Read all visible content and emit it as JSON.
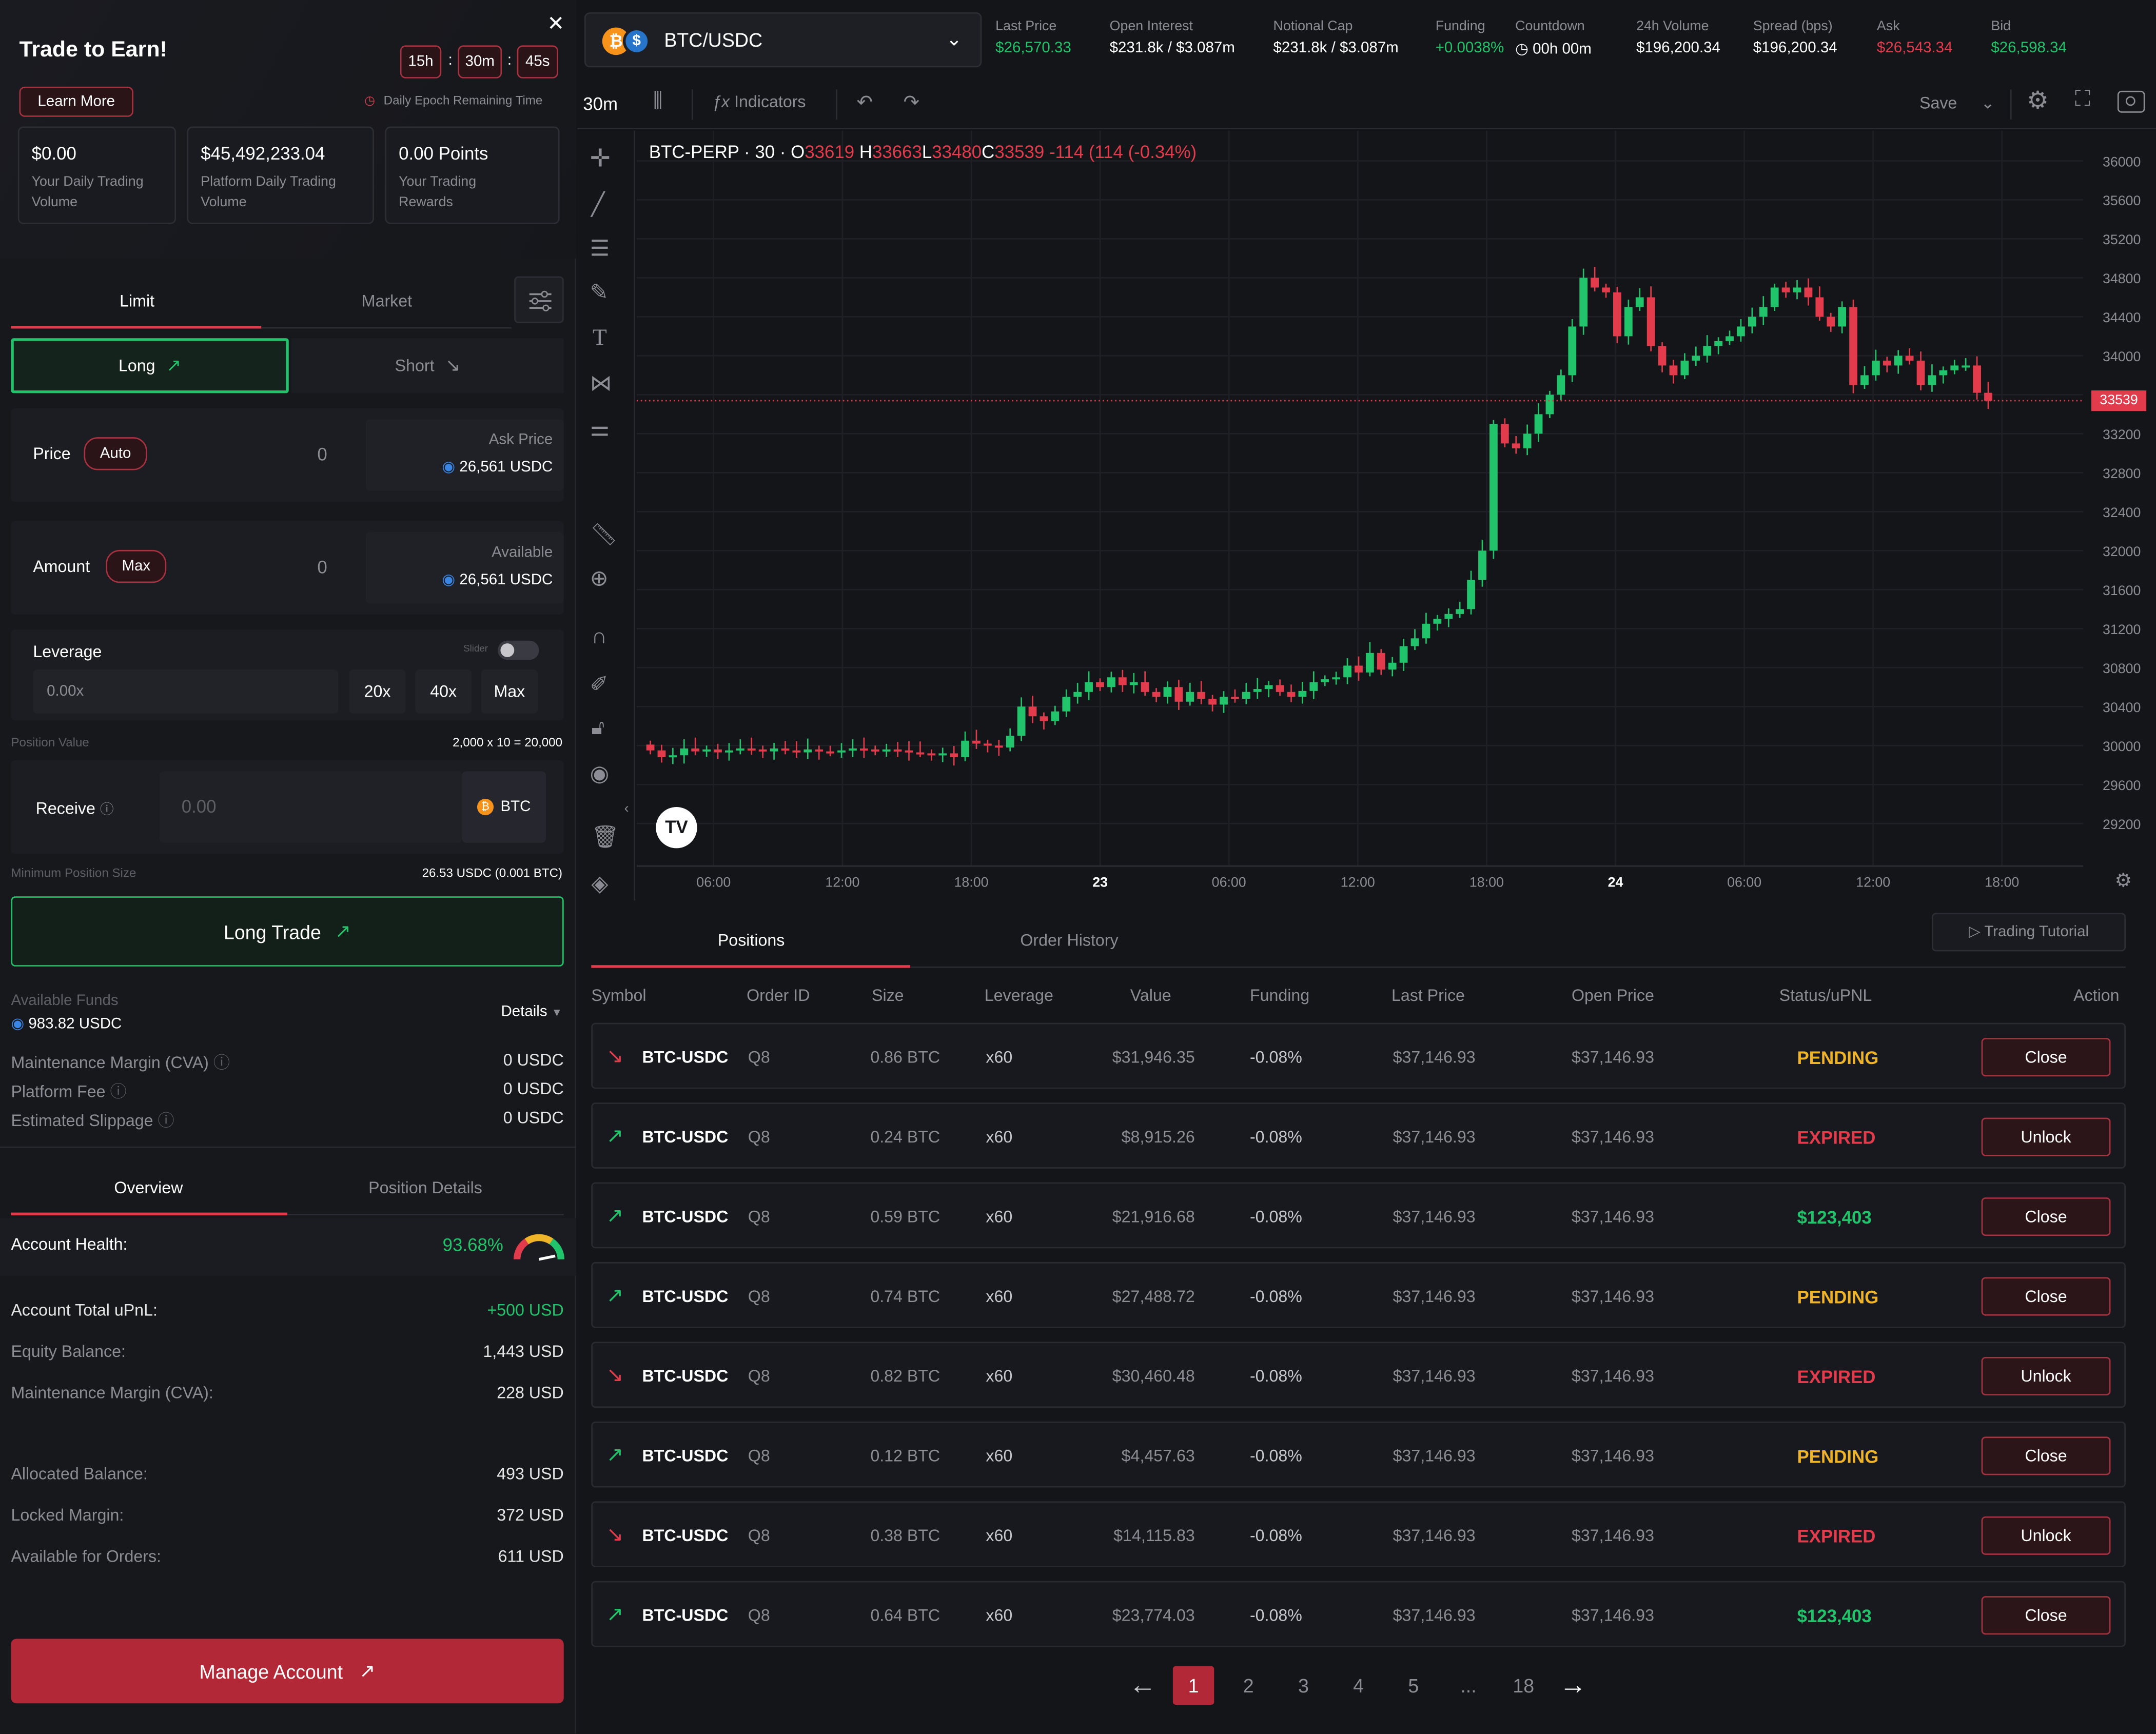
{
  "earn": {
    "title": "Trade to Earn!",
    "learn_more": "Learn More",
    "timer": {
      "h": "15h",
      "m": "30m",
      "s": "45s",
      "sep": ":"
    },
    "epoch_label": "Daily Epoch Remaining Time",
    "cards": [
      {
        "value": "$0.00",
        "label": "Your Daily Trading Volume"
      },
      {
        "value": "$45,492,233.04",
        "label": "Platform Daily Trading Volume"
      },
      {
        "value": "0.00 Points",
        "label": "Your Trading Rewards"
      }
    ]
  },
  "order": {
    "tabs": {
      "limit": "Limit",
      "market": "Market"
    },
    "long": "Long",
    "short": "Short",
    "price_label": "Price",
    "price_auto": "Auto",
    "price_value": "0",
    "ask_label": "Ask Price",
    "ask_value": "26,561 USDC",
    "amount_label": "Amount",
    "amount_max": "Max",
    "amount_value": "0",
    "available_label": "Available",
    "available_value": "26,561 USDC",
    "leverage_label": "Leverage",
    "slider_label": "Slider",
    "leverage_value": "0.00x",
    "leverage_opts": [
      "20x",
      "40x",
      "Max"
    ],
    "position_value_label": "Position Value",
    "position_value": "2,000 x 10 = 20,000",
    "receive_label": "Receive",
    "receive_value": "0.00",
    "receive_token": "BTC",
    "min_size_label": "Minimum Position Size",
    "min_size_value": "26.53 USDC (0.001 BTC)",
    "submit": "Long Trade"
  },
  "funds": {
    "available_label": "Available Funds",
    "available_value": "983.82 USDC",
    "details": "Details",
    "rows": [
      {
        "k": "Maintenance Margin (CVA)",
        "v": "0 USDC"
      },
      {
        "k": "Platform Fee",
        "v": "0 USDC"
      },
      {
        "k": "Estimated Slippage",
        "v": "0 USDC"
      }
    ]
  },
  "overview": {
    "tabs": {
      "overview": "Overview",
      "position_details": "Position Details"
    },
    "health_label": "Account Health:",
    "health_value": "93.68%",
    "health_fraction": 0.9368,
    "rows": [
      {
        "k": "Account Total uPnL:",
        "v": "+500 USD"
      },
      {
        "k": "Equity Balance:",
        "v": "1,443 USD"
      },
      {
        "k": "Maintenance Margin (CVA):",
        "v": "228 USD"
      },
      {
        "k": "Allocated Balance:",
        "v": "493 USD"
      },
      {
        "k": "Locked Margin:",
        "v": "372 USD"
      },
      {
        "k": "Available for Orders:",
        "v": "611 USD"
      }
    ],
    "manage": "Manage Account"
  },
  "market": {
    "pair": "BTC/USDC",
    "stats": [
      {
        "label": "Last Price",
        "value": "$26,570.33",
        "color": "#21c46a"
      },
      {
        "label": "Open Interest",
        "value": "$231.8k / $3.087m",
        "color": "#ffffff"
      },
      {
        "label": "Notional Cap",
        "value": "$231.8k / $3.087m",
        "color": "#ffffff"
      },
      {
        "label": "Funding",
        "value": "+0.0038%",
        "color": "#21c46a"
      },
      {
        "label": "Countdown",
        "value": "00h 00m",
        "color": "#ffffff"
      },
      {
        "label": "24h Volume",
        "value": "$196,200.34",
        "color": "#ffffff"
      },
      {
        "label": "Spread (bps)",
        "value": "$196,200.34",
        "color": "#ffffff"
      },
      {
        "label": "Ask",
        "value": "$26,543.34",
        "color": "#e23b4c"
      },
      {
        "label": "Bid",
        "value": "$26,598.34",
        "color": "#21c46a"
      }
    ]
  },
  "toolbar": {
    "interval": "30m",
    "indicators": "Indicators",
    "save": "Save"
  },
  "chart_legend": {
    "symbol": "BTC-PERP · 30 ·",
    "o_label": "O",
    "o": "33619",
    "h_label": "H",
    "h": "33663",
    "l_label": "L",
    "l": "33480",
    "c_label": "C",
    "c": "33539",
    "change": "-114 (114 (-0.34%)"
  },
  "chart_data": {
    "type": "candlestick",
    "symbol": "BTC-PERP",
    "interval": "30",
    "ylim": [
      29000,
      36000
    ],
    "y_ticks": [
      36000,
      35600,
      35200,
      34800,
      34400,
      34000,
      33600,
      33200,
      32800,
      32400,
      32000,
      31600,
      31200,
      30800,
      30400,
      30000,
      29600,
      29200
    ],
    "x_ticks": [
      "06:00",
      "12:00",
      "18:00",
      "23",
      "06:00",
      "12:00",
      "18:00",
      "24",
      "06:00",
      "12:00",
      "18:00"
    ],
    "last_price_label": "33539",
    "last_price": 33539,
    "close_series": [
      29950,
      29880,
      29900,
      29970,
      29940,
      29960,
      29930,
      29950,
      29970,
      29960,
      29940,
      29970,
      29950,
      29930,
      29960,
      29940,
      29930,
      29950,
      29970,
      29960,
      29940,
      29960,
      29950,
      29930,
      29920,
      29900,
      29920,
      29880,
      30050,
      30020,
      30000,
      29980,
      30100,
      30400,
      30300,
      30250,
      30350,
      30500,
      30550,
      30650,
      30600,
      30700,
      30620,
      30650,
      30550,
      30500,
      30600,
      30450,
      30550,
      30480,
      30420,
      30500,
      30480,
      30550,
      30580,
      30620,
      30550,
      30500,
      30560,
      30650,
      30680,
      30700,
      30820,
      30750,
      30950,
      30780,
      30850,
      31020,
      31100,
      31250,
      31300,
      31350,
      31400,
      31700,
      32000,
      33300,
      33100,
      33050,
      33200,
      33400,
      33600,
      33800,
      34300,
      34800,
      34700,
      34650,
      34200,
      34500,
      34600,
      34100,
      33900,
      33800,
      33950,
      34000,
      34100,
      34150,
      34200,
      34300,
      34400,
      34500,
      34700,
      34650,
      34700,
      34600,
      34400,
      34300,
      34500,
      33700,
      33800,
      33950,
      33900,
      34000,
      33950,
      33700,
      33800,
      33850,
      33900,
      33900,
      33620,
      33539
    ]
  },
  "tabs": {
    "positions": "Positions",
    "order_history": "Order History",
    "tutorial": "Trading Tutorial"
  },
  "table": {
    "headers": [
      "Symbol",
      "Order ID",
      "Size",
      "Leverage",
      "Value",
      "Funding",
      "Last Price",
      "Open Price",
      "Status/uPNL",
      "Action"
    ],
    "rows": [
      {
        "dir": "down",
        "symbol": "BTC-USDC",
        "id": "Q8",
        "size": "0.86 BTC",
        "lev": "x60",
        "value": "$31,946.35",
        "funding": "-0.08%",
        "last": "$37,146.93",
        "open": "$37,146.93",
        "status": "PENDING",
        "status_color": "#f0b429",
        "action": "Close"
      },
      {
        "dir": "up",
        "symbol": "BTC-USDC",
        "id": "Q8",
        "size": "0.24 BTC",
        "lev": "x60",
        "value": "$8,915.26",
        "funding": "-0.08%",
        "last": "$37,146.93",
        "open": "$37,146.93",
        "status": "EXPIRED",
        "status_color": "#e23b4c",
        "action": "Unlock"
      },
      {
        "dir": "up",
        "symbol": "BTC-USDC",
        "id": "Q8",
        "size": "0.59 BTC",
        "lev": "x60",
        "value": "$21,916.68",
        "funding": "-0.08%",
        "last": "$37,146.93",
        "open": "$37,146.93",
        "status": "$123,403",
        "status_color": "#21c46a",
        "action": "Close"
      },
      {
        "dir": "up",
        "symbol": "BTC-USDC",
        "id": "Q8",
        "size": "0.74 BTC",
        "lev": "x60",
        "value": "$27,488.72",
        "funding": "-0.08%",
        "last": "$37,146.93",
        "open": "$37,146.93",
        "status": "PENDING",
        "status_color": "#f0b429",
        "action": "Close"
      },
      {
        "dir": "down",
        "symbol": "BTC-USDC",
        "id": "Q8",
        "size": "0.82 BTC",
        "lev": "x60",
        "value": "$30,460.48",
        "funding": "-0.08%",
        "last": "$37,146.93",
        "open": "$37,146.93",
        "status": "EXPIRED",
        "status_color": "#e23b4c",
        "action": "Unlock"
      },
      {
        "dir": "up",
        "symbol": "BTC-USDC",
        "id": "Q8",
        "size": "0.12 BTC",
        "lev": "x60",
        "value": "$4,457.63",
        "funding": "-0.08%",
        "last": "$37,146.93",
        "open": "$37,146.93",
        "status": "PENDING",
        "status_color": "#f0b429",
        "action": "Close"
      },
      {
        "dir": "down",
        "symbol": "BTC-USDC",
        "id": "Q8",
        "size": "0.38 BTC",
        "lev": "x60",
        "value": "$14,115.83",
        "funding": "-0.08%",
        "last": "$37,146.93",
        "open": "$37,146.93",
        "status": "EXPIRED",
        "status_color": "#e23b4c",
        "action": "Unlock"
      },
      {
        "dir": "up",
        "symbol": "BTC-USDC",
        "id": "Q8",
        "size": "0.64 BTC",
        "lev": "x60",
        "value": "$23,774.03",
        "funding": "-0.08%",
        "last": "$37,146.93",
        "open": "$37,146.93",
        "status": "$123,403",
        "status_color": "#21c46a",
        "action": "Close"
      }
    ]
  },
  "pagination": {
    "pages": [
      "1",
      "2",
      "3",
      "4",
      "5",
      "...",
      "18"
    ],
    "current": "1"
  }
}
